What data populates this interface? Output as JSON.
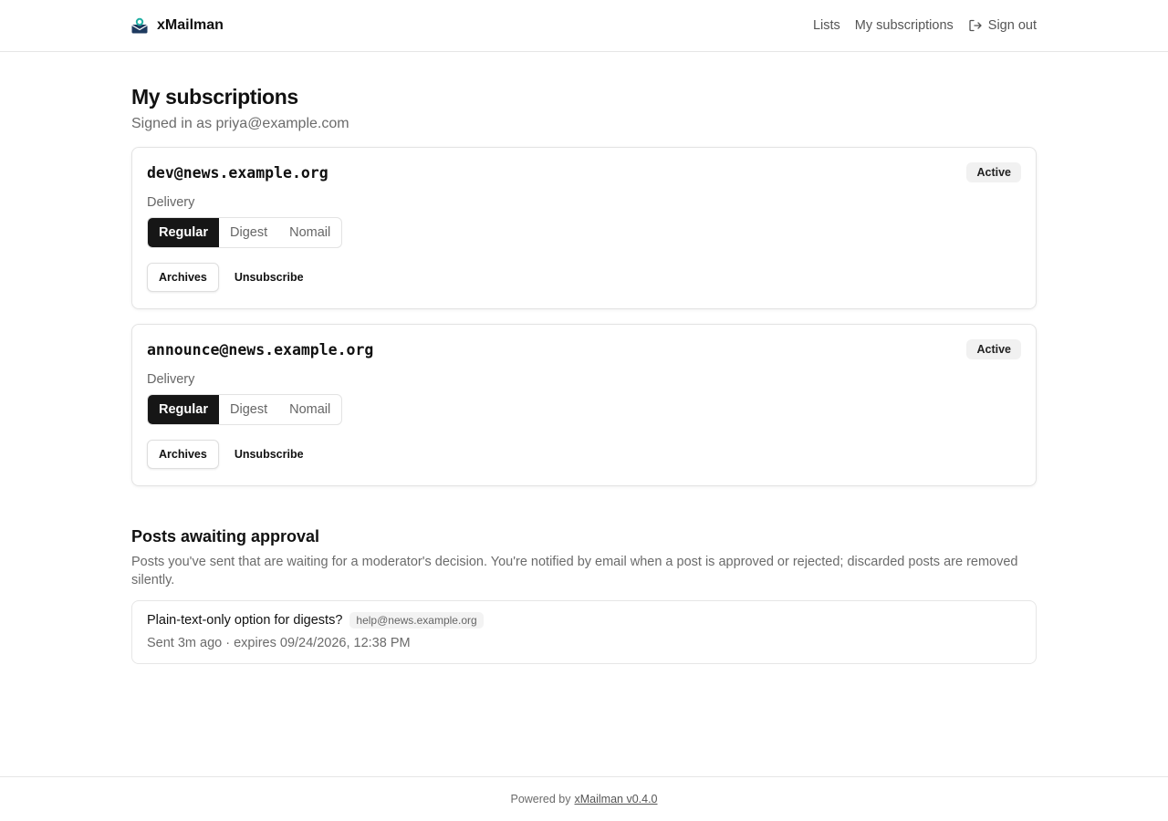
{
  "header": {
    "brand": "xMailman",
    "nav": {
      "lists": "Lists",
      "subscriptions": "My subscriptions",
      "signout": "Sign out"
    }
  },
  "page": {
    "title": "My subscriptions",
    "subtitle": "Signed in as priya@example.com"
  },
  "subscriptions": [
    {
      "address": "dev@news.example.org",
      "status": "Active",
      "delivery_label": "Delivery",
      "modes": [
        "Regular",
        "Digest",
        "Nomail"
      ],
      "selected_mode": "Regular",
      "archives_label": "Archives",
      "unsubscribe_label": "Unsubscribe"
    },
    {
      "address": "announce@news.example.org",
      "status": "Active",
      "delivery_label": "Delivery",
      "modes": [
        "Regular",
        "Digest",
        "Nomail"
      ],
      "selected_mode": "Regular",
      "archives_label": "Archives",
      "unsubscribe_label": "Unsubscribe"
    }
  ],
  "pending": {
    "title": "Posts awaiting approval",
    "description": "Posts you've sent that are waiting for a moderator's decision. You're notified by email when a post is approved or rejected; discarded posts are removed silently.",
    "items": [
      {
        "subject": "Plain-text-only option for digests?",
        "list": "help@news.example.org",
        "meta": "Sent 3m ago · expires 09/24/2026, 12:38 PM"
      }
    ]
  },
  "footer": {
    "prefix": "Powered by",
    "link": "xMailman v0.4.0"
  },
  "colors": {
    "accent": "#161616",
    "badge_bg": "#f1f1f1",
    "border": "#e3e3e3",
    "muted_text": "#6b6b6b"
  },
  "icons": {
    "brand": "mailbox-logo-icon",
    "signout": "sign-out-icon"
  }
}
